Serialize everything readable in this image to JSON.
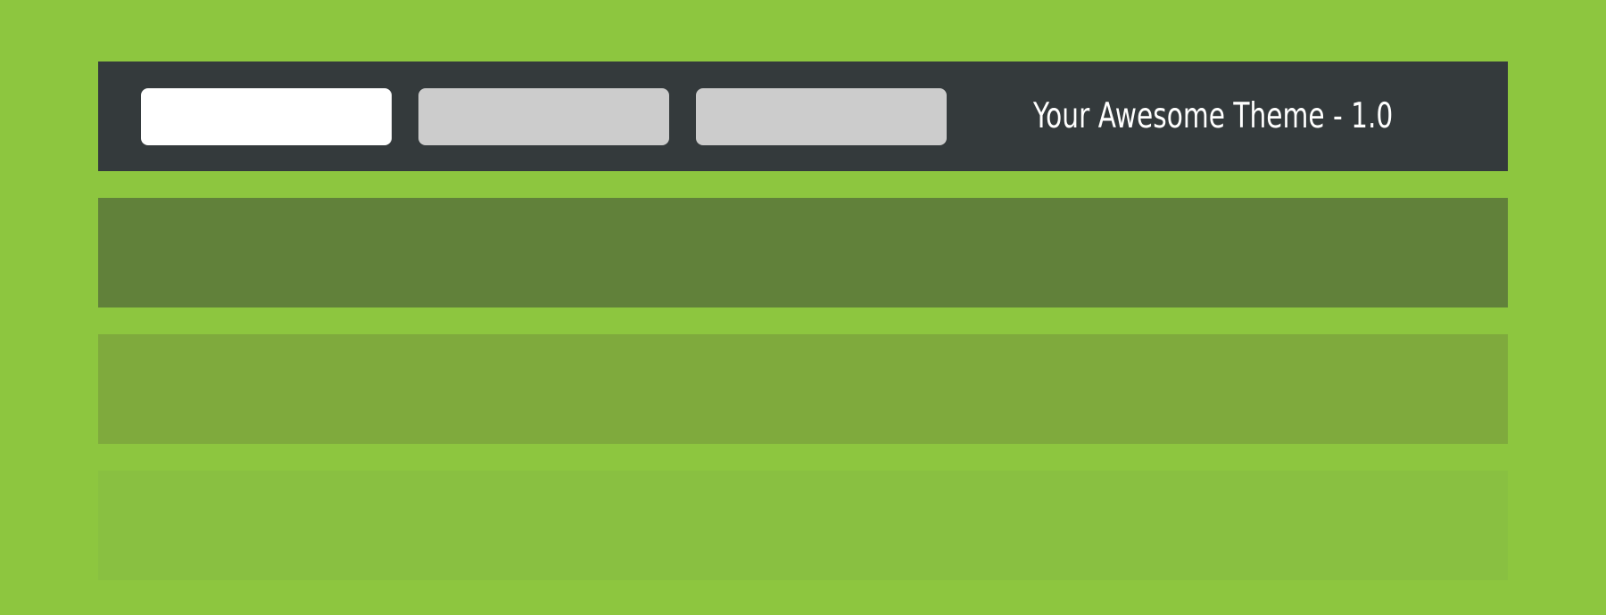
{
  "header": {
    "title": "Your Awesome Theme - 1.0",
    "tabs": [
      {
        "label": "",
        "active": true
      },
      {
        "label": "",
        "active": false
      },
      {
        "label": "",
        "active": false
      }
    ]
  },
  "colors": {
    "background": "#8dc63f",
    "header_bar": "#343a3c",
    "tab_active": "#ffffff",
    "tab_inactive": "#cccccc",
    "title_text": "#ffffff",
    "band_dark": "#61813a",
    "band_medium": "#7faa3d",
    "band_light": "#89c041"
  }
}
